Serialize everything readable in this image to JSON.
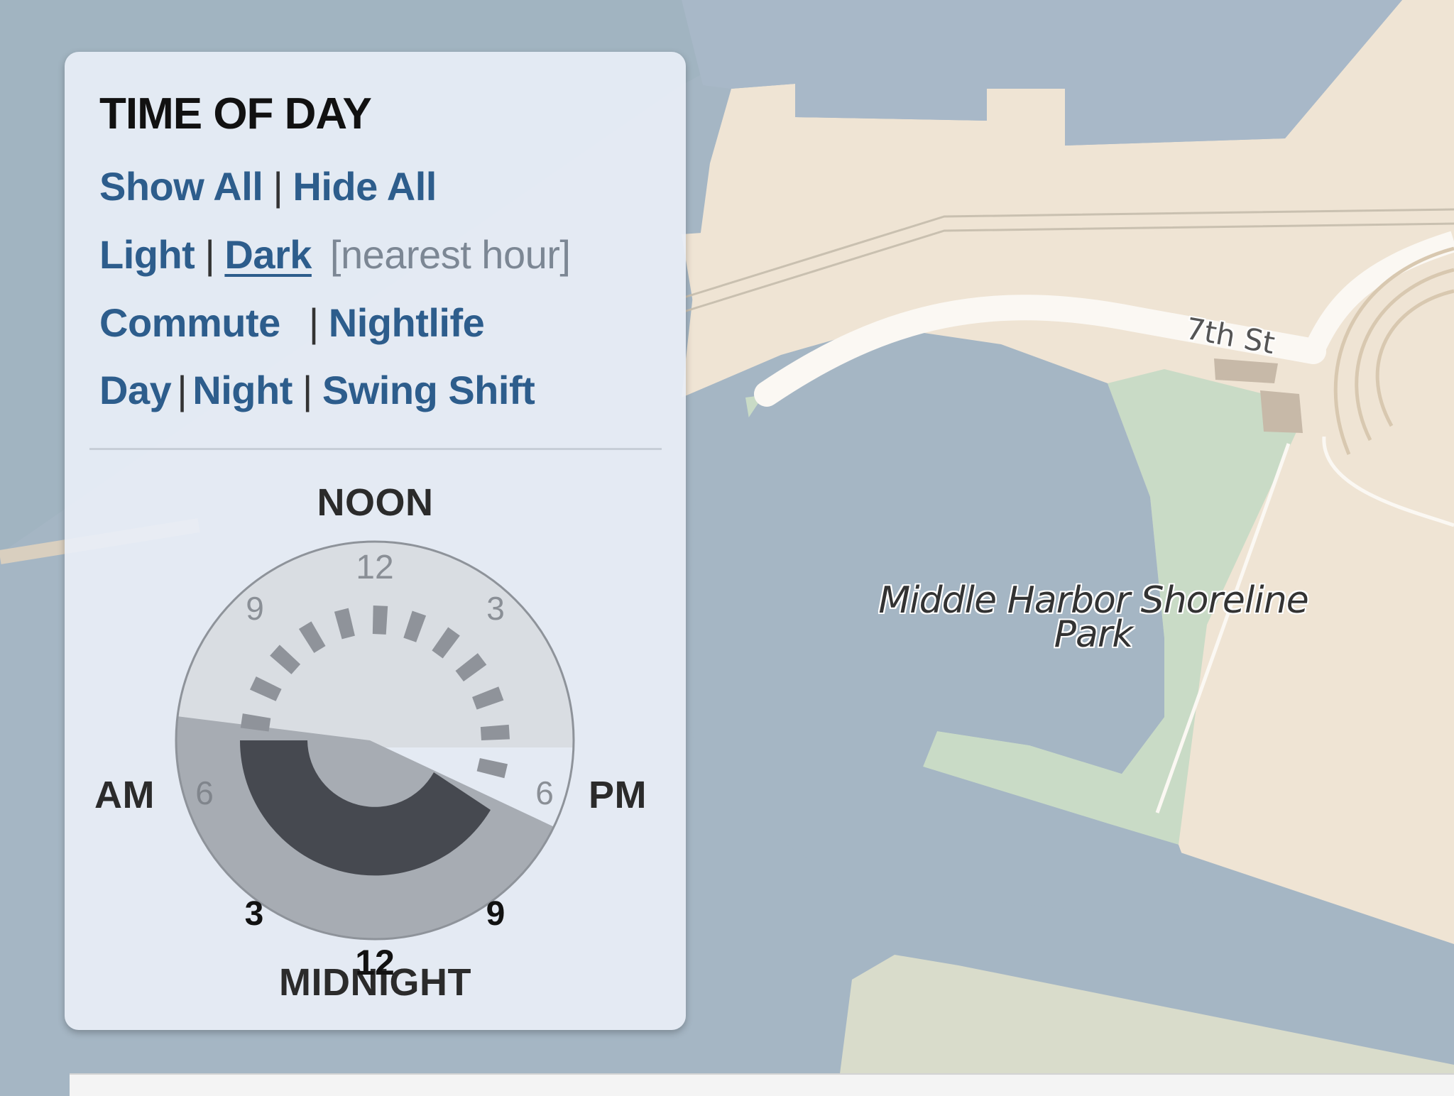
{
  "map": {
    "park_label": "Middle Harbor Shoreline Park",
    "street_label": "7th St",
    "colors": {
      "water": "#a5b6c4",
      "land": "#efe4d4",
      "park": "#c9dbc6",
      "road": "#fbf8f3"
    }
  },
  "panel": {
    "title": "TIME OF DAY",
    "links": {
      "show_all": "Show All",
      "hide_all": "Hide All",
      "light": "Light",
      "dark": "Dark",
      "nearest_hour": "[nearest hour]",
      "commute": "Commute",
      "nightlife": "Nightlife",
      "day": "Day",
      "night": "Night",
      "swing_shift": "Swing Shift",
      "separator": "|"
    },
    "active_link": "Dark",
    "link_color": "#2d5d8c"
  },
  "clock": {
    "noon_label": "NOON",
    "midnight_label": "MIDNIGHT",
    "am_label": "AM",
    "pm_label": "PM",
    "day_numbers": [
      "12",
      "3",
      "6",
      "9"
    ],
    "night_numbers": [
      "12",
      "3",
      "6",
      "9"
    ],
    "day_hours_bars": 12,
    "night_arc_hours": "18:00-06:00",
    "colors": {
      "day_face": "#d9dde2",
      "night_face": "#a7acb3",
      "dark_arc": "#464950",
      "day_ticks": "#8f939a"
    }
  }
}
